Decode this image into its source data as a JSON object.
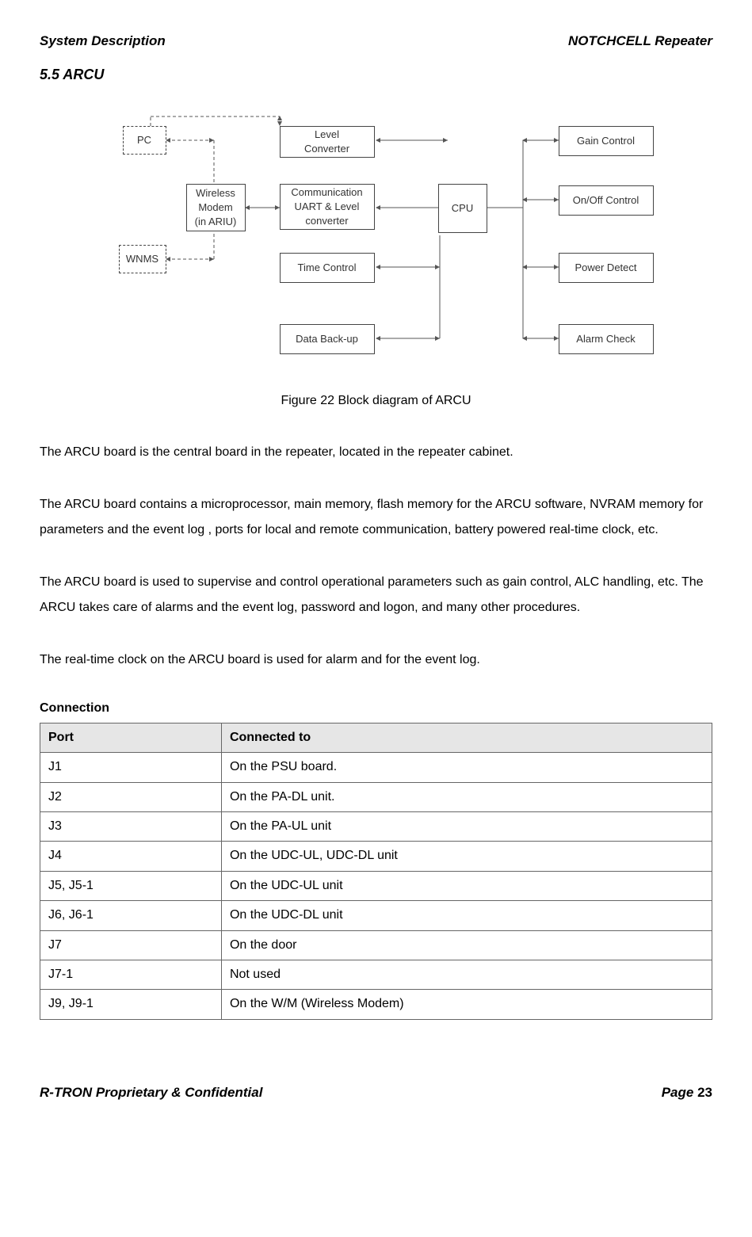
{
  "header": {
    "left": "System Description",
    "right": "NOTCHCELL Repeater"
  },
  "section": "5.5 ARCU",
  "diagram": {
    "pc": "PC",
    "wnms": "WNMS",
    "modem": "Wireless\nModem\n(in ARIU)",
    "level_conv": "Level\nConverter",
    "comm": "Communication\nUART & Level\nconverter",
    "time": "Time Control",
    "backup": "Data Back-up",
    "cpu": "CPU",
    "gain": "Gain Control",
    "onoff": "On/Off Control",
    "power": "Power Detect",
    "alarm": "Alarm Check"
  },
  "caption": "Figure 22 Block diagram of ARCU",
  "paragraphs": [
    "The ARCU board is the central board in the repeater, located in the repeater cabinet.",
    "The ARCU board contains a microprocessor, main memory, flash memory for the ARCU software, NVRAM memory for parameters and the event log , ports for local and remote communication, battery powered real-time clock, etc.",
    "The ARCU board is used to supervise and control operational parameters such as gain control, ALC handling, etc. The ARCU takes care of alarms and the event log, password and logon, and many other procedures.",
    "The real-time clock on the ARCU board is used for alarm and for the event log."
  ],
  "connection": {
    "heading": "Connection",
    "columns": [
      "Port",
      "Connected to"
    ],
    "rows": [
      [
        "J1",
        "On the PSU board."
      ],
      [
        "J2",
        "On the PA-DL unit."
      ],
      [
        "J3",
        "On the PA-UL unit"
      ],
      [
        "J4",
        "On the UDC-UL, UDC-DL unit"
      ],
      [
        "J5, J5-1",
        "On the UDC-UL unit"
      ],
      [
        "J6, J6-1",
        "On the UDC-DL unit"
      ],
      [
        "J7",
        "On the door"
      ],
      [
        "J7-1",
        "Not used"
      ],
      [
        "J9, J9-1",
        "On the W/M (Wireless Modem)"
      ]
    ]
  },
  "footer": {
    "left": "R-TRON Proprietary & Confidential",
    "page_label": "Page ",
    "page_num": "23"
  }
}
